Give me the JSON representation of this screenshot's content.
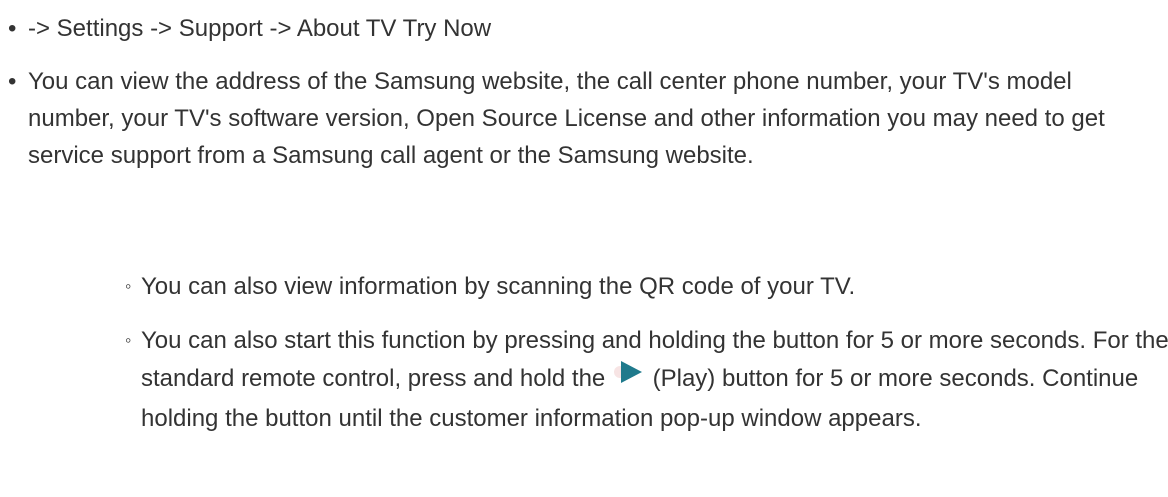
{
  "item1": {
    "path": "-> Settings -> Support -> About TV",
    "link": "Try Now"
  },
  "item2": {
    "text": "You can view the address of the Samsung website, the call center phone number, your TV's model number, your TV's software version, Open Source License and other information you may need to get service support from a Samsung call agent or the Samsung website."
  },
  "sub1": {
    "text": "You can also view information by scanning the QR code of your TV."
  },
  "sub2": {
    "text_before": "You can also start this function by pressing and holding the button for 5 or more seconds. For the standard remote control, press and hold the",
    "icon": "play-icon",
    "icon_color": "#1f7a8c",
    "text_after": "(Play) button for 5 or more seconds. Continue holding the button until the customer information pop-up window appears."
  }
}
